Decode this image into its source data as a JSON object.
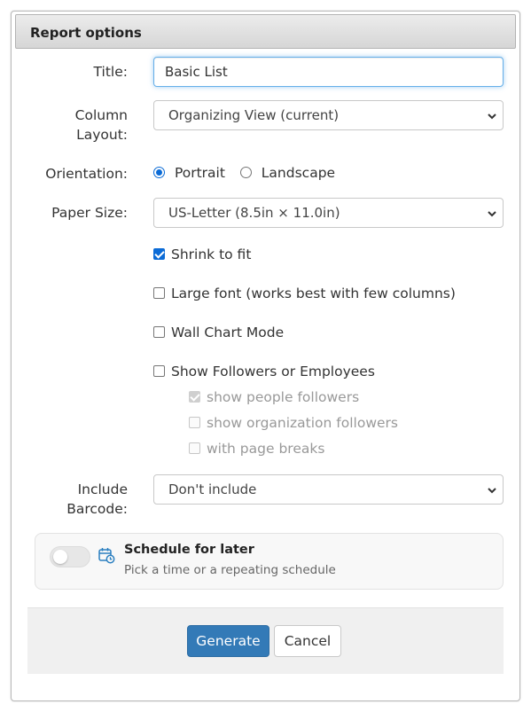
{
  "dialog": {
    "title": "Report options"
  },
  "form": {
    "title_label": "Title:",
    "title_value": "Basic List",
    "column_layout_label_line1": "Column",
    "column_layout_label_line2": "Layout:",
    "column_layout_value": "Organizing View (current)",
    "orientation_label": "Orientation:",
    "orientation_options": [
      {
        "label": "Portrait",
        "selected": true
      },
      {
        "label": "Landscape",
        "selected": false
      }
    ],
    "paper_size_label": "Paper Size:",
    "paper_size_value": "US-Letter (8.5in × 11.0in)",
    "checkboxes": [
      {
        "label": "Shrink to fit",
        "checked": true,
        "disabled": false
      },
      {
        "label": "Large font (works best with few columns)",
        "checked": false,
        "disabled": false
      },
      {
        "label": "Wall Chart Mode",
        "checked": false,
        "disabled": false
      },
      {
        "label": "Show Followers or Employees",
        "checked": false,
        "disabled": false
      }
    ],
    "sub_checkboxes": [
      {
        "label": "show people followers",
        "checked": true,
        "disabled": true
      },
      {
        "label": "show organization followers",
        "checked": false,
        "disabled": true
      },
      {
        "label": "with page breaks",
        "checked": false,
        "disabled": true
      }
    ],
    "barcode_label_line1": "Include",
    "barcode_label_line2": "Barcode:",
    "barcode_value": "Don't include"
  },
  "schedule": {
    "title": "Schedule for later",
    "subtitle": "Pick a time or a repeating schedule",
    "enabled": false
  },
  "footer": {
    "generate_label": "Generate",
    "cancel_label": "Cancel"
  },
  "colors": {
    "primary": "#337ab7",
    "focus": "#66afe9",
    "check_accent": "#0b6bd6",
    "schedule_icon": "#2a7fc0"
  }
}
